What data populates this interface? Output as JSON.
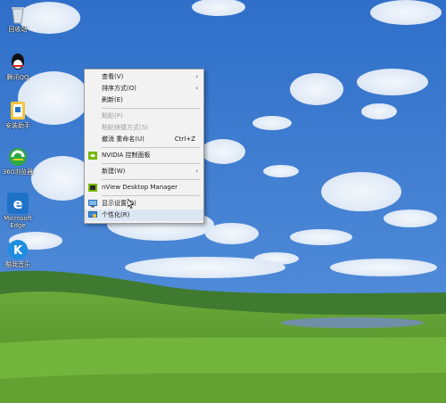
{
  "desktop_icons": [
    {
      "name": "recycle-bin-icon",
      "label": "回收站",
      "color": "#cfd8e0"
    },
    {
      "name": "qq-icon",
      "label": "腾讯QQ",
      "color": "#111111"
    },
    {
      "name": "settings-app-icon",
      "label": "安装助手",
      "color": "#f5c542"
    },
    {
      "name": "browser-360-icon",
      "label": "360浏览器",
      "color": "#2ea844"
    },
    {
      "name": "edge-icon",
      "label": "Microsoft Edge",
      "color": "#1e73c8"
    },
    {
      "name": "k-app-icon",
      "label": "酷我音乐",
      "color": "#1d8de0"
    }
  ],
  "context_menu": {
    "items": [
      {
        "label": "查看(V)",
        "submenu": true
      },
      {
        "label": "排序方式(O)",
        "submenu": true
      },
      {
        "label": "刷新(E)"
      },
      {
        "separator": true
      },
      {
        "label": "粘贴(P)",
        "disabled": true
      },
      {
        "label": "粘贴快捷方式(S)",
        "disabled": true
      },
      {
        "label": "撤消 重命名(U)",
        "shortcut": "Ctrl+Z"
      },
      {
        "separator": true
      },
      {
        "label": "NVIDIA 控制面板",
        "icon": "nvidia-icon"
      },
      {
        "separator": true
      },
      {
        "label": "新建(W)",
        "submenu": true
      },
      {
        "separator": true
      },
      {
        "label": "nView Desktop Manager",
        "icon": "nview-icon"
      },
      {
        "separator": true
      },
      {
        "label": "显示设置(D)",
        "icon": "display-settings-icon"
      },
      {
        "label": "个性化(R)",
        "icon": "personalize-icon",
        "hover": true
      }
    ]
  },
  "colors": {
    "sky": "#3a78cc",
    "grass": "#5a9a2c",
    "menu_bg": "#f2f2f2",
    "hover": "#dbe6f3"
  }
}
